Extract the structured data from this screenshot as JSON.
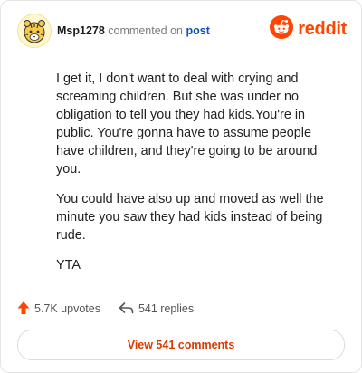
{
  "header": {
    "username": "Msp1278",
    "action_text": "commented on",
    "post_link": "post",
    "brand": "reddit",
    "avatar_icon": "tiger-avatar-icon",
    "logo_icon": "reddit-alien-icon",
    "brand_color": "#ff4500"
  },
  "comment": {
    "paragraphs": [
      "I get it, I don't want to deal with crying and screaming children. But she was under no obligation to tell you they had kids.You're in public. You're gonna have to assume people have children, and they're going to be around you.",
      "You could have also up and moved as well the minute you saw they had kids instead of being rude.",
      "YTA"
    ]
  },
  "actions": {
    "upvotes": "5.7K upvotes",
    "replies": "541 replies",
    "upvote_icon": "upvote-arrow-icon",
    "reply_icon": "reply-arrow-icon"
  },
  "footer": {
    "view_comments": "View 541 comments"
  }
}
